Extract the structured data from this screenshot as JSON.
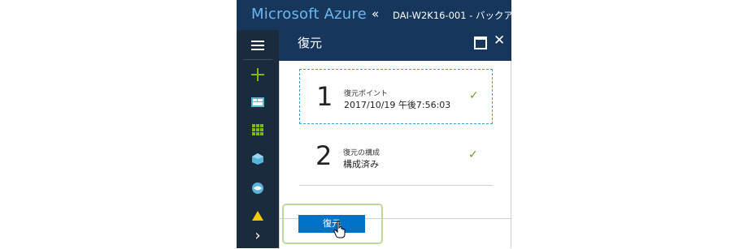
{
  "header": {
    "brand": "Microsoft Azure",
    "collapse_icon": "«",
    "breadcrumb": "DAI-W2K16-001 - バックア"
  },
  "sidebar": {
    "icons": [
      "menu-icon",
      "plus-icon",
      "dashboard-icon",
      "all-resources-icon",
      "resource-groups-icon",
      "app-services-icon",
      "warning-icon",
      "chevron-right-icon"
    ]
  },
  "blade": {
    "title": "復元",
    "steps": [
      {
        "number": "1",
        "label": "復元ポイント",
        "value": "2017/10/19 午後7:56:03",
        "check": "✓"
      },
      {
        "number": "2",
        "label": "復元の構成",
        "value": "構成済み",
        "check": "✓"
      }
    ],
    "restore_button": "復元"
  },
  "colors": {
    "header_bg": "#16365c",
    "sidebar_bg": "#1a2b3d",
    "brand_blue": "#6bb8f0",
    "accent_blue": "#0072c6",
    "check_green": "#6aa321",
    "highlight_green": "#c0d99a"
  }
}
